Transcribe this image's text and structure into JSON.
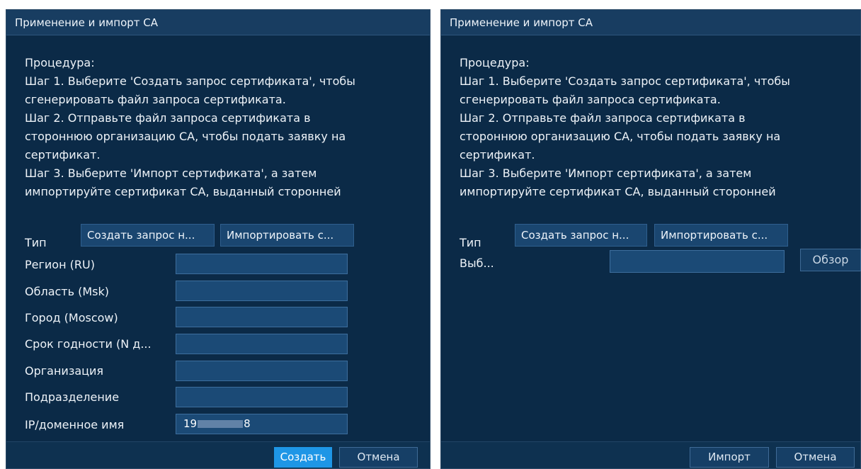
{
  "left": {
    "title": "Применение и импорт CA",
    "procedure": [
      "Процедура:",
      " Шаг 1. Выберите 'Создать запрос сертификата', чтобы",
      "сгенерировать файл запроса сертификата.",
      " Шаг 2. Отправьте файл запроса сертификата в",
      "стороннюю организацию CA, чтобы подать заявку на",
      "сертификат.",
      " Шаг 3. Выберите 'Импорт сертификата', а затем",
      "импортируйте сертификат CA, выданный сторонней"
    ],
    "type_label": "Тип",
    "type_buttons": [
      "Создать запрос н...",
      "Импортировать с..."
    ],
    "fields": [
      {
        "label": "Регион (RU)",
        "value": ""
      },
      {
        "label": "Область (Msk)",
        "value": ""
      },
      {
        "label": "Город (Moscow)",
        "value": ""
      },
      {
        "label": "Срок годности (N д...",
        "value": ""
      },
      {
        "label": "Организация",
        "value": ""
      },
      {
        "label": "Подразделение",
        "value": ""
      },
      {
        "label": "IP/доменное имя",
        "value_start": "19",
        "value_end": "8"
      }
    ],
    "create_label": "Создать",
    "cancel_label": "Отмена"
  },
  "right": {
    "title": "Применение и импорт CA",
    "procedure": [
      "Процедура:",
      " Шаг 1. Выберите 'Создать запрос сертификата', чтобы",
      "сгенерировать файл запроса сертификата.",
      " Шаг 2. Отправьте файл запроса сертификата в",
      "стороннюю организацию CA, чтобы подать заявку на",
      "сертификат.",
      " Шаг 3. Выберите 'Импорт сертификата', а затем",
      "импортируйте сертификат CA, выданный сторонней"
    ],
    "type_label": "Тип",
    "type_buttons": [
      "Создать запрос н...",
      "Импортировать с..."
    ],
    "select_label": "Выб...",
    "browse_label": "Обзор",
    "import_label": "Импорт",
    "cancel_label": "Отмена"
  }
}
